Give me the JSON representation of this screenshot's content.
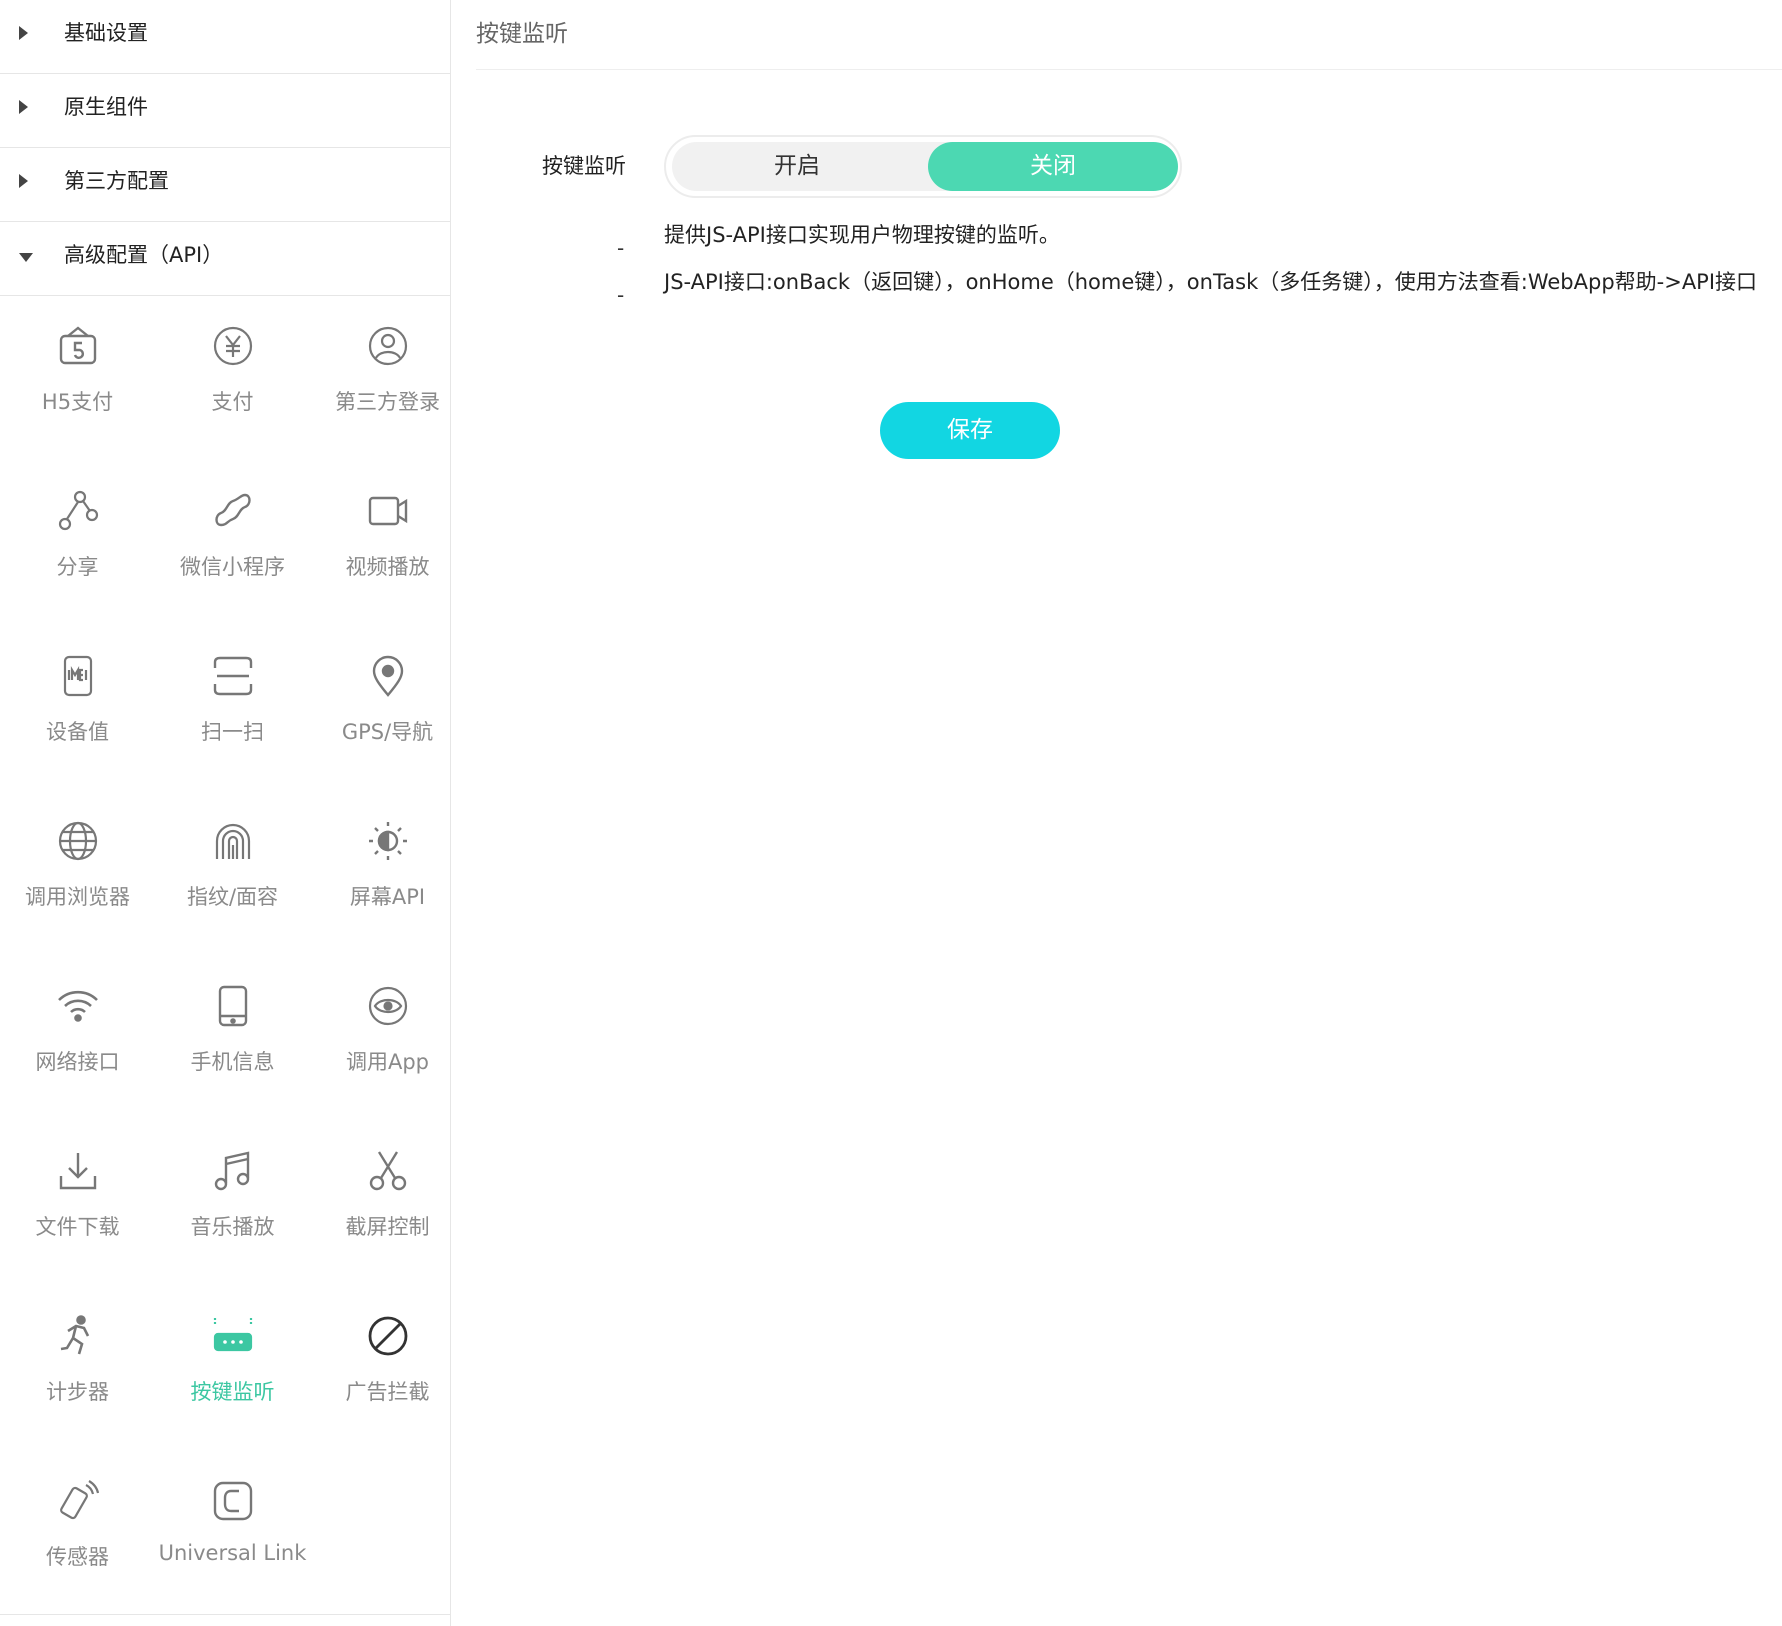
{
  "sidebar": {
    "sections": [
      {
        "label": "基础设置",
        "expanded": false
      },
      {
        "label": "原生组件",
        "expanded": false
      },
      {
        "label": "第三方配置",
        "expanded": false
      },
      {
        "label": "高级配置（API）",
        "expanded": true
      }
    ],
    "items": [
      {
        "label": "H5支付",
        "icon": "h5-pay-icon"
      },
      {
        "label": "支付",
        "icon": "yuan-coin-icon"
      },
      {
        "label": "第三方登录",
        "icon": "user-circle-icon"
      },
      {
        "label": "分享",
        "icon": "share-icon"
      },
      {
        "label": "微信小程序",
        "icon": "mini-program-icon"
      },
      {
        "label": "视频播放",
        "icon": "video-camera-icon"
      },
      {
        "label": "设备值",
        "icon": "imei-icon"
      },
      {
        "label": "扫一扫",
        "icon": "scan-icon"
      },
      {
        "label": "GPS/导航",
        "icon": "location-pin-icon"
      },
      {
        "label": "调用浏览器",
        "icon": "globe-icon"
      },
      {
        "label": "指纹/面容",
        "icon": "fingerprint-icon"
      },
      {
        "label": "屏幕API",
        "icon": "brightness-icon"
      },
      {
        "label": "网络接口",
        "icon": "wifi-icon"
      },
      {
        "label": "手机信息",
        "icon": "phone-icon"
      },
      {
        "label": "调用App",
        "icon": "eye-icon"
      },
      {
        "label": "文件下载",
        "icon": "download-icon"
      },
      {
        "label": "音乐播放",
        "icon": "music-note-icon"
      },
      {
        "label": "截屏控制",
        "icon": "scissors-icon"
      },
      {
        "label": "计步器",
        "icon": "running-icon"
      },
      {
        "label": "按键监听",
        "icon": "keyboard-icon",
        "active": true
      },
      {
        "label": "广告拦截",
        "icon": "block-icon"
      },
      {
        "label": "传感器",
        "icon": "vibrating-phone-icon"
      },
      {
        "label": "Universal Link",
        "icon": "universal-link-icon"
      }
    ]
  },
  "main": {
    "title": "按键监听",
    "field_label": "按键监听",
    "toggle": {
      "on_label": "开启",
      "off_label": "关闭",
      "selected": "关闭"
    },
    "descriptions": [
      "提供JS-API接口实现用户物理按键的监听。",
      "JS-API接口:onBack（返回键），onHome（home键），onTask（多任务键），使用方法查看:WebApp帮助->API接口"
    ],
    "dash": "-",
    "save_label": "保存"
  },
  "colors": {
    "accent": "#4cd8b2",
    "save_button": "#12d6e2",
    "active_item": "#3cc7a2"
  }
}
